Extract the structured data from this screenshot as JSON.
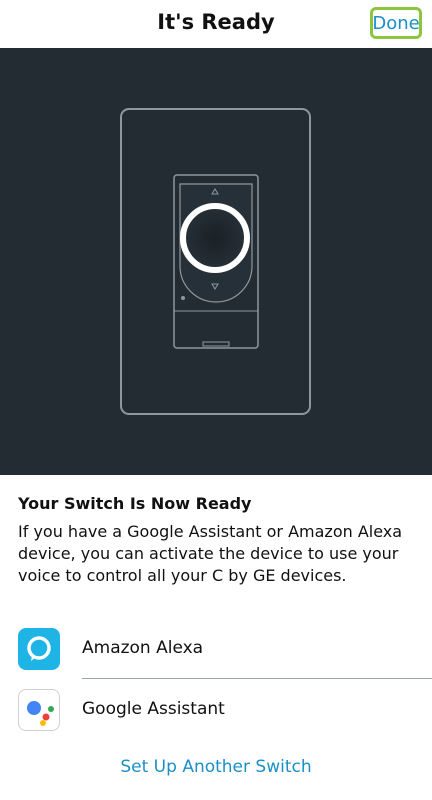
{
  "header": {
    "title": "It's Ready",
    "done_label": "Done"
  },
  "content": {
    "title": "Your Switch Is Now Ready",
    "description": "If you have a Google Assistant or Amazon Alexa device, you can activate the device to use your voice to control all your C by GE devices."
  },
  "integrations": [
    {
      "label": "Amazon Alexa",
      "icon": "amazon-alexa-icon"
    },
    {
      "label": "Google Assistant",
      "icon": "google-assistant-icon"
    }
  ],
  "footer": {
    "setup_another_label": "Set Up Another Switch"
  },
  "colors": {
    "accent": "#1a8fc8",
    "highlight": "#8cc63f",
    "hero_background": "#232c33",
    "alexa_blue": "#1fb4e6"
  }
}
